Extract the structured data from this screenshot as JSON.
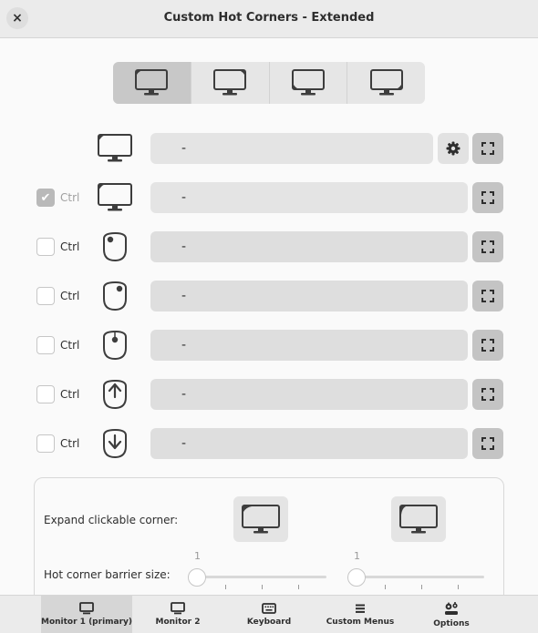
{
  "window": {
    "title": "Custom Hot Corners - Extended",
    "close_icon": "×"
  },
  "corner_tabs": [
    {
      "name": "top-left",
      "active": true
    },
    {
      "name": "top-right",
      "active": false
    },
    {
      "name": "bottom-left",
      "active": false
    },
    {
      "name": "bottom-right",
      "active": false
    }
  ],
  "rows": [
    {
      "trigger": "hot-corner",
      "checkbox": null,
      "action": "-",
      "has_settings": true
    },
    {
      "trigger": "ctrl-hot-corner",
      "checkbox": {
        "label": "Ctrl",
        "checked": true
      },
      "action": "-"
    },
    {
      "trigger": "primary-button",
      "checkbox": {
        "label": "Ctrl",
        "checked": false
      },
      "action": "-"
    },
    {
      "trigger": "secondary-button",
      "checkbox": {
        "label": "Ctrl",
        "checked": false
      },
      "action": "-"
    },
    {
      "trigger": "middle-button",
      "checkbox": {
        "label": "Ctrl",
        "checked": false
      },
      "action": "-"
    },
    {
      "trigger": "scroll-up",
      "checkbox": {
        "label": "Ctrl",
        "checked": false
      },
      "action": "-"
    },
    {
      "trigger": "scroll-down",
      "checkbox": {
        "label": "Ctrl",
        "checked": false
      },
      "action": "-"
    }
  ],
  "options": {
    "expand_label": "Expand clickable corner:",
    "barrier_label": "Hot corner barrier size:",
    "barrier_h_value": "1",
    "barrier_v_value": "1"
  },
  "nav": [
    {
      "label": "Monitor 1 (primary)",
      "icon": "monitor-icon",
      "active": true
    },
    {
      "label": "Monitor 2",
      "icon": "monitor-icon",
      "active": false
    },
    {
      "label": "Keyboard",
      "icon": "keyboard-icon",
      "active": false
    },
    {
      "label": "Custom Menus",
      "icon": "menu-icon",
      "active": false
    },
    {
      "label": "Options",
      "icon": "options-icon",
      "active": false
    }
  ]
}
